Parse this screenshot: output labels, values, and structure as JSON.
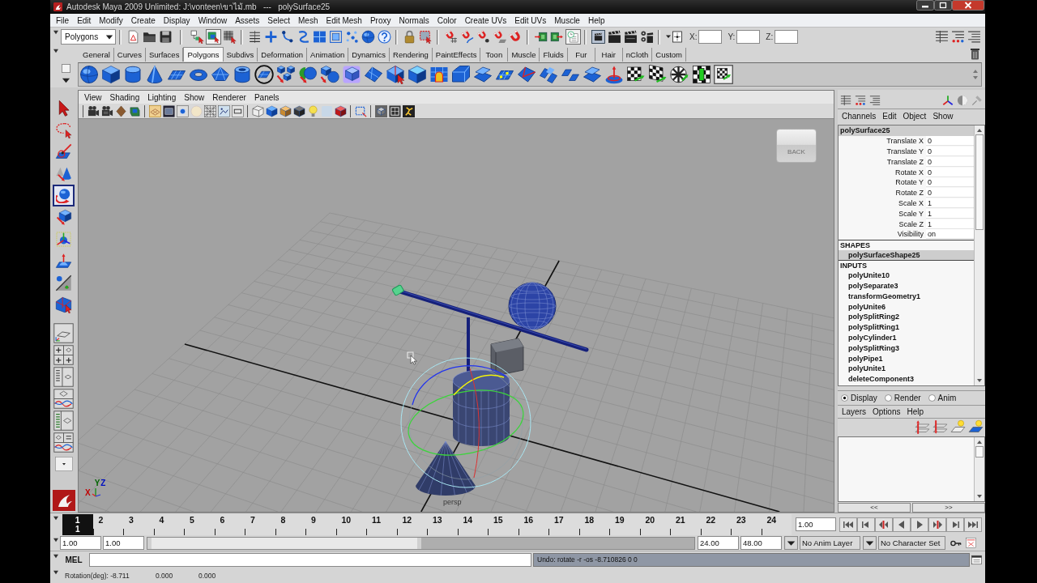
{
  "window": {
    "title": "Autodesk Maya 2009 Unlimited: J:\\vonteen\\ขาไม้.mb   ---   polySurface25"
  },
  "menu_bar": [
    "File",
    "Edit",
    "Modify",
    "Create",
    "Display",
    "Window",
    "Assets",
    "Select",
    "Mesh",
    "Edit Mesh",
    "Proxy",
    "Normals",
    "Color",
    "Create UVs",
    "Edit UVs",
    "Muscle",
    "Help"
  ],
  "status_line": {
    "menu_set": "Polygons",
    "selection_modes": [
      {
        "selected": false
      },
      {
        "selected": true
      },
      {
        "selected": false
      }
    ],
    "construction_history": {
      "on": true
    },
    "coordinate_fields": [
      {
        "label": "X:"
      },
      {
        "label": "Y:"
      },
      {
        "label": "Z:"
      }
    ]
  },
  "shelf": {
    "tabs": [
      {
        "label": "General",
        "selected": false
      },
      {
        "label": "Curves",
        "selected": false
      },
      {
        "label": "Surfaces",
        "selected": false
      },
      {
        "label": "Polygons",
        "selected": true
      },
      {
        "label": "Subdivs",
        "selected": false
      },
      {
        "label": "Deformation",
        "selected": false
      },
      {
        "label": "Animation",
        "selected": false
      },
      {
        "label": "Dynamics",
        "selected": false
      },
      {
        "label": "Rendering",
        "selected": false
      },
      {
        "label": "PaintEffects",
        "selected": false
      },
      {
        "label": "Toon",
        "selected": false
      },
      {
        "label": "Muscle",
        "selected": false
      },
      {
        "label": "Fluids",
        "selected": false
      },
      {
        "label": "Fur",
        "selected": false
      },
      {
        "label": "Hair",
        "selected": false
      },
      {
        "label": "nCloth",
        "selected": false
      },
      {
        "label": "Custom",
        "selected": false
      }
    ]
  },
  "toolbox": {
    "tools": [
      {
        "selected": false
      },
      {
        "selected": false
      },
      {
        "selected": false
      },
      {
        "selected": false
      },
      {
        "selected": true
      },
      {
        "selected": false
      },
      {
        "selected": false
      },
      {
        "selected": false
      },
      {
        "selected": false
      },
      {
        "selected": false
      }
    ]
  },
  "viewport": {
    "menu": [
      "View",
      "Shading",
      "Lighting",
      "Show",
      "Renderer",
      "Panels"
    ],
    "view_cube": {
      "label": "BACK"
    },
    "axis_labels": [
      "X",
      "Y",
      "Z"
    ],
    "camera_label": "persp"
  },
  "channel_box": {
    "menu": [
      "Channels",
      "Edit",
      "Object",
      "Show"
    ],
    "object": "polySurface25",
    "channels": [
      {
        "name": "Translate X",
        "value": "0"
      },
      {
        "name": "Translate Y",
        "value": "0"
      },
      {
        "name": "Translate Z",
        "value": "0"
      },
      {
        "name": "Rotate X",
        "value": "0"
      },
      {
        "name": "Rotate Y",
        "value": "0"
      },
      {
        "name": "Rotate Z",
        "value": "0"
      },
      {
        "name": "Scale X",
        "value": "1"
      },
      {
        "name": "Scale Y",
        "value": "1"
      },
      {
        "name": "Scale Z",
        "value": "1"
      },
      {
        "name": "Visibility",
        "value": "on"
      }
    ],
    "shapes_header": "SHAPES",
    "shapes": [
      {
        "label": "polySurfaceShape25",
        "selected": true
      }
    ],
    "inputs_header": "INPUTS",
    "inputs": [
      "polyUnite10",
      "polySeparate3",
      "transformGeometry1",
      "polyUnite6",
      "polySplitRing2",
      "polySplitRing1",
      "polyCylinder1",
      "polySplitRing3",
      "polyPipe1",
      "polyUnite1",
      "deleteComponent3"
    ]
  },
  "layer_editor": {
    "modes": [
      {
        "label": "Display",
        "selected": true
      },
      {
        "label": "Render",
        "selected": false
      },
      {
        "label": "Anim",
        "selected": false
      }
    ],
    "menu": [
      "Layers",
      "Options",
      "Help"
    ],
    "page_buttons": [
      "<<",
      ">>"
    ]
  },
  "time_slider": {
    "frames": [
      {
        "label": "1",
        "selected": true
      },
      {
        "label": "2",
        "selected": false
      },
      {
        "label": "3",
        "selected": false
      },
      {
        "label": "4",
        "selected": false
      },
      {
        "label": "5",
        "selected": false
      },
      {
        "label": "6",
        "selected": false
      },
      {
        "label": "7",
        "selected": false
      },
      {
        "label": "8",
        "selected": false
      },
      {
        "label": "9",
        "selected": false
      },
      {
        "label": "10",
        "selected": false
      },
      {
        "label": "11",
        "selected": false
      },
      {
        "label": "12",
        "selected": false
      },
      {
        "label": "13",
        "selected": false
      },
      {
        "label": "14",
        "selected": false
      },
      {
        "label": "15",
        "selected": false
      },
      {
        "label": "16",
        "selected": false
      },
      {
        "label": "17",
        "selected": false
      },
      {
        "label": "18",
        "selected": false
      },
      {
        "label": "19",
        "selected": false
      },
      {
        "label": "20",
        "selected": false
      },
      {
        "label": "21",
        "selected": false
      },
      {
        "label": "22",
        "selected": false
      },
      {
        "label": "23",
        "selected": false
      },
      {
        "label": "24",
        "selected": false
      }
    ],
    "current_frame": "1",
    "current_time": "1.00"
  },
  "range_slider": {
    "start_time": "1.00",
    "range_start": "1.00",
    "level": 0.5,
    "range_end": "24.00",
    "end_time": "48.00",
    "anim_layer": "No Anim Layer",
    "character_set": "No Character Set"
  },
  "command_line": {
    "language": "MEL",
    "result": "Undo: rotate -r -os -8.710826 0 0"
  },
  "help_line": {
    "texts": [
      "Rotation(deg): -8.711",
      "0.000",
      "0.000"
    ]
  }
}
